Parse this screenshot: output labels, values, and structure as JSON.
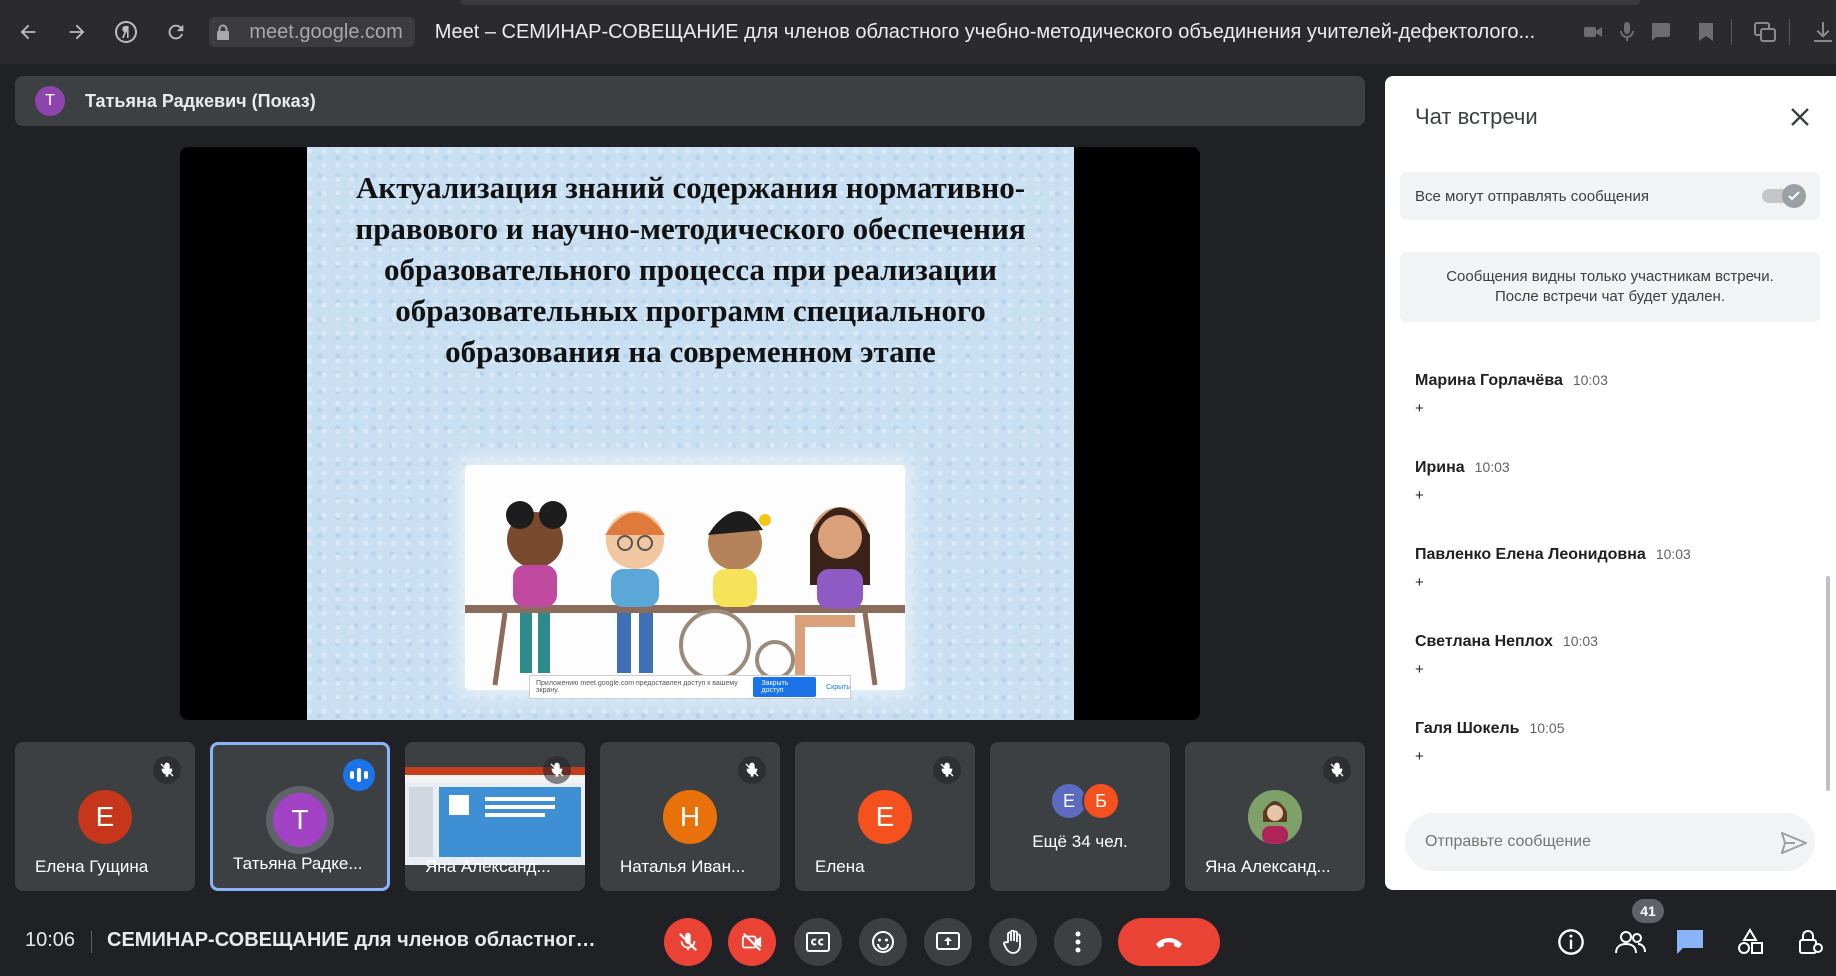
{
  "browser": {
    "url": "meet.google.com",
    "tab_title": "Meet – СЕМИНАР-СОВЕЩАНИЕ для членов областного учебно-методического объединения учителей-дефектолого..."
  },
  "presenter": {
    "initial": "Т",
    "label": "Татьяна Радкевич (Показ)",
    "avatar_color": "#8e44ad"
  },
  "slide": {
    "title": "Актуализация знаний содержания нормативно-правового и научно-методического обеспечения образовательного процесса при реализации образовательных программ специального образования на современном этапе",
    "share_notice": "Приложению meet.google.com предоставлен доступ к вашему экрану.",
    "share_stop": "Закрыть доступ",
    "share_hide": "Скрыть"
  },
  "tiles": [
    {
      "name": "Елена Гущина",
      "initial": "Е",
      "color": "#c5361b",
      "muted": true
    },
    {
      "name": "Татьяна Радке...",
      "initial": "Т",
      "color": "#a142c4",
      "speaking": true
    },
    {
      "name": "Яна Александ...",
      "screen": true,
      "muted": true
    },
    {
      "name": "Наталья Иван...",
      "initial": "Н",
      "color": "#e8710a",
      "muted": true
    },
    {
      "name": "Елена",
      "initial": "Е",
      "color": "#f4511e",
      "muted": true
    },
    {
      "name": "Ещё 34 чел.",
      "more": true,
      "avatars": [
        {
          "initial": "Е",
          "color": "#5c6bc0"
        },
        {
          "initial": "Б",
          "color": "#f4511e"
        }
      ]
    },
    {
      "name": "Яна Александ...",
      "photo": true,
      "muted": true
    }
  ],
  "chat": {
    "title": "Чат встречи",
    "toggle_label": "Все могут отправлять сообщения",
    "toggle_on": true,
    "notice_line1": "Сообщения видны только участникам встречи.",
    "notice_line2": "После встречи чат будет удален.",
    "messages": [
      {
        "sender": "Марина Горлачёва",
        "time": "10:03",
        "text": "+"
      },
      {
        "sender": "Ирина",
        "time": "10:03",
        "text": "+"
      },
      {
        "sender": "Павленко Елена Леонидовна",
        "time": "10:03",
        "text": "+"
      },
      {
        "sender": "Светлана Неплох",
        "time": "10:03",
        "text": "+"
      },
      {
        "sender": "Галя Шокель",
        "time": "10:05",
        "text": "+"
      }
    ],
    "input_placeholder": "Отправьте сообщение"
  },
  "bottom": {
    "time": "10:06",
    "meeting_title": "СЕМИНАР-СОВЕЩАНИЕ для членов областного ...",
    "participant_count": "41"
  },
  "colors": {
    "accent": "#8ab4f8",
    "danger": "#ea4335",
    "chat_active": "#8ab4f8"
  }
}
